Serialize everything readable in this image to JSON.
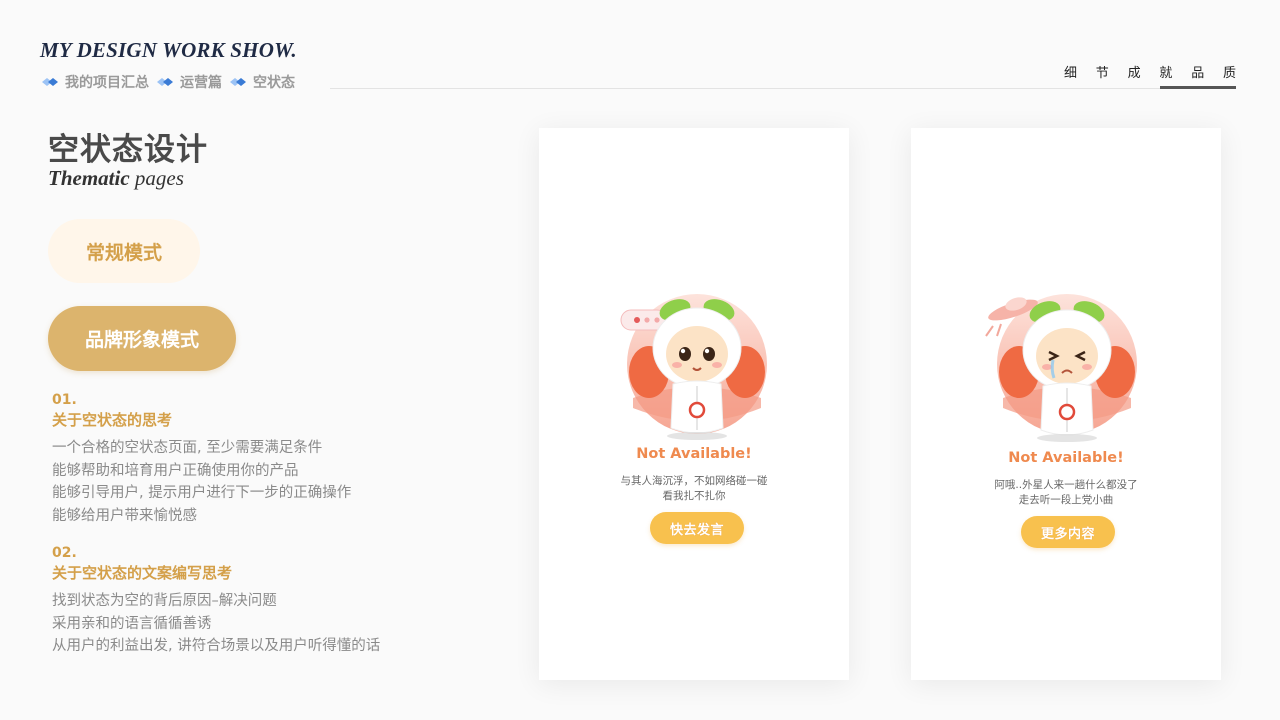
{
  "header": {
    "brand_title": "MY DESIGN WORK SHOW.",
    "breadcrumb": [
      "我的项目汇总",
      "运营篇",
      "空状态"
    ],
    "tagline": [
      "细",
      "节",
      "成",
      "就",
      "品",
      "质"
    ],
    "accent_color": "#3a7bd5"
  },
  "intro": {
    "title": "空状态设计",
    "subtitle_bold": "Thematic",
    "subtitle_rest": " pages"
  },
  "modes": {
    "normal_label": "常规模式",
    "brand_label": "品牌形象模式"
  },
  "sections": [
    {
      "num": "01.",
      "heading": "关于空状态的思考",
      "lines": [
        "一个合格的空状态页面, 至少需要满足条件",
        "能够帮助和培育用户正确使用你的产品",
        "能够引导用户, 提示用户进行下一步的正确操作",
        "能够给用户带来愉悦感"
      ]
    },
    {
      "num": "02.",
      "heading": "关于空状态的文案编写思考",
      "lines": [
        "找到状态为空的背后原因–解决问题",
        "采用亲和的语言循循善诱",
        "从用户的利益出发, 讲符合场景以及用户听得懂的话"
      ]
    }
  ],
  "phones": [
    {
      "status_title": "Not Available!",
      "message_lines": [
        "与其人海沉浮，不如网络碰一碰",
        "看我扎不扎你"
      ],
      "button_label": "快去发言",
      "mascot_icon": "mascot-happy-icon"
    },
    {
      "status_title": "Not Available!",
      "message_lines": [
        "阿哦..外星人来一趟什么都没了",
        "走去听一段上党小曲"
      ],
      "button_label": "更多内容",
      "mascot_icon": "mascot-sad-icon"
    }
  ],
  "colors": {
    "gold": "#d4a04a",
    "gold_button": "#dcb46d",
    "orange_title": "#ef8a4f",
    "cta_yellow": "#f8c14e"
  }
}
